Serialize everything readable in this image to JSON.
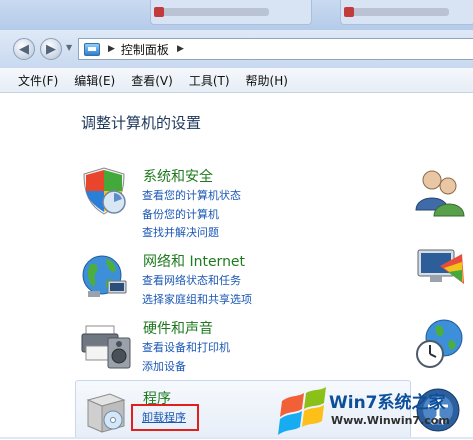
{
  "window": {
    "breadcrumb": "控制面板"
  },
  "menu": [
    {
      "label": "文件(F)"
    },
    {
      "label": "编辑(E)"
    },
    {
      "label": "查看(V)"
    },
    {
      "label": "工具(T)"
    },
    {
      "label": "帮助(H)"
    }
  ],
  "heading": "调整计算机的设置",
  "categories": [
    {
      "title": "系统和安全",
      "links": [
        "查看您的计算机状态",
        "备份您的计算机",
        "查找并解决问题"
      ]
    },
    {
      "title": "网络和 Internet",
      "links": [
        "查看网络状态和任务",
        "选择家庭组和共享选项"
      ]
    },
    {
      "title": "硬件和声音",
      "links": [
        "查看设备和打印机",
        "添加设备"
      ]
    },
    {
      "title": "程序",
      "links": [
        "卸载程序"
      ]
    }
  ],
  "watermark": {
    "title": "Win7系统之家",
    "url": "Www.Winwin7.com"
  },
  "colors": {
    "category_title": "#1e7a1e",
    "link": "#1a57b5",
    "highlight_box": "#e0201c"
  }
}
